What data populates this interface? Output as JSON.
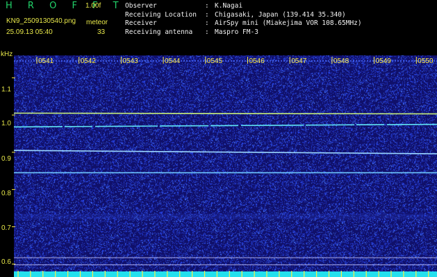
{
  "app": {
    "title": "H R O F F T",
    "version": "1.00f",
    "filename": "KN9_2509130540.png",
    "datetime": "25.09.13 05:40",
    "meteor_label": "meteor",
    "meteor_count": "33"
  },
  "info": [
    {
      "key": "Observer",
      "value": "K.Nagai"
    },
    {
      "key": "Receiving Location",
      "value": "Chigasaki, Japan (139.414 35.340)"
    },
    {
      "key": "Receiver",
      "value": "AirSpy mini (Miakejima VOR 108.65MHz)"
    },
    {
      "key": "Receiving antenna",
      "value": "Maspro FM-3"
    }
  ],
  "spectrogram": {
    "y_unit": "kHz",
    "y_ticks": [
      "1.1",
      "1.0",
      "0.9",
      "0.8",
      "0.7",
      "0.6"
    ],
    "y_range": [
      0.58,
      1.16
    ],
    "time_labels": [
      "0541",
      "0542",
      "0543",
      "0544",
      "0545",
      "0546",
      "0547",
      "0548",
      "0549",
      "0550"
    ],
    "signal_lines": [
      {
        "from_khz": 1.005,
        "to_khz": 1.003,
        "color": "#c8f07a",
        "kind": "strong"
      },
      {
        "from_khz": 0.968,
        "to_khz": 0.975,
        "color": "#60e6f6",
        "kind": "dashed"
      },
      {
        "from_khz": 0.905,
        "to_khz": 0.896,
        "color": "#9ad6ff",
        "kind": "solid"
      },
      {
        "from_khz": 0.845,
        "to_khz": 0.845,
        "color": "#6fc8ff",
        "kind": "solid"
      },
      {
        "from_khz": 0.617,
        "to_khz": 0.617,
        "color": "#c8c8ff",
        "kind": "thin"
      },
      {
        "from_khz": 0.598,
        "to_khz": 0.598,
        "color": "#c8c8ff",
        "kind": "thin"
      }
    ],
    "colors": {
      "background": "#10106a",
      "noise": "#3a5cff",
      "bottom_band": "#24e0ee",
      "marker": "#ffee44"
    }
  }
}
